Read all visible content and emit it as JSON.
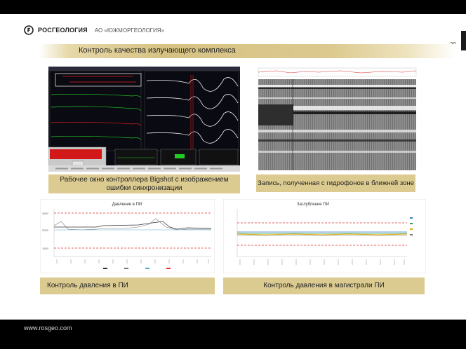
{
  "header": {
    "logo_text": "РОСГЕОЛОГИЯ",
    "logo_sub": "АО «ЮЖМОРГЕОЛОГИЯ»",
    "page_number": "29"
  },
  "slide": {
    "title": "Контроль качества излучающего комплекса"
  },
  "panels": {
    "controller": {
      "caption": "Рабочее окно контроллера Bigshot с изображением ошибки синхронизации"
    },
    "hydrophone": {
      "caption": "Запись, полученная с гидрофонов в ближней зоне"
    },
    "pressure": {
      "caption": "Контроль давления в ПИ"
    },
    "depth": {
      "caption": "Контроль давления в магистрали ПИ"
    }
  },
  "charts": {
    "pressure_title": "Давление в ПИ",
    "depth_title": "Заглубление ПИ"
  },
  "footer": {
    "url": "www.rosgeo.com"
  },
  "colors": {
    "band": "#d6c283",
    "caption_bg": "#dccb91",
    "bar": "#000000"
  }
}
